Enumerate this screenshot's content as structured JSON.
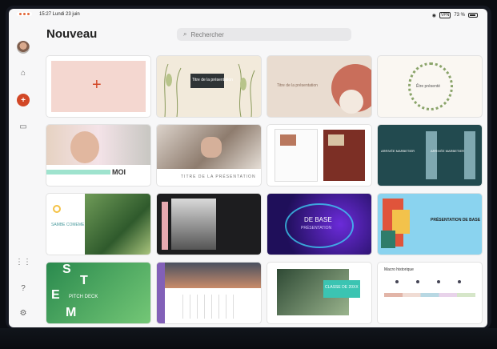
{
  "status": {
    "time": "15:27 Lundi 23 juin",
    "battery_label": "73 %",
    "battery_box": "VPN"
  },
  "header": {
    "title": "Nouveau",
    "search_placeholder": "Rechercher"
  },
  "sidebar": {
    "items": [
      {
        "icon": "avatar"
      },
      {
        "icon": "home-icon"
      },
      {
        "icon": "new-icon"
      },
      {
        "icon": "folder-icon"
      },
      {
        "icon": "apps-icon"
      },
      {
        "icon": "help-icon"
      },
      {
        "icon": "settings-icon"
      }
    ]
  },
  "templates": {
    "blank": {
      "label": ""
    },
    "t2": {
      "title": "Titre de la présentation"
    },
    "t3": {
      "title": "Titre de la présentation"
    },
    "t4": {
      "title": "Être présenté"
    },
    "t5": {
      "title": "MOI"
    },
    "t6": {
      "title": "TITRE DE LA PRÉSENTATION"
    },
    "t8": {
      "title1": "ARRIVÉE MARBETIER",
      "title2": "ARRIVÉE MARBETIER"
    },
    "t9": {
      "title": "SAMBE COMEME"
    },
    "t11": {
      "title": "DE BASE",
      "sub": "PRÉSENTATION"
    },
    "t12": {
      "title": "PRÉSENTATION DE BASE"
    },
    "t13": {
      "title": "PITCH DECK",
      "letters": [
        "S",
        "T",
        "E",
        "M",
        "M"
      ]
    },
    "t15": {
      "title": "CLASSE DE 20XX"
    },
    "t16": {
      "title": "Macro historique"
    }
  },
  "colors": {
    "accent": "#d24726",
    "bg": "#f7f7f8"
  }
}
